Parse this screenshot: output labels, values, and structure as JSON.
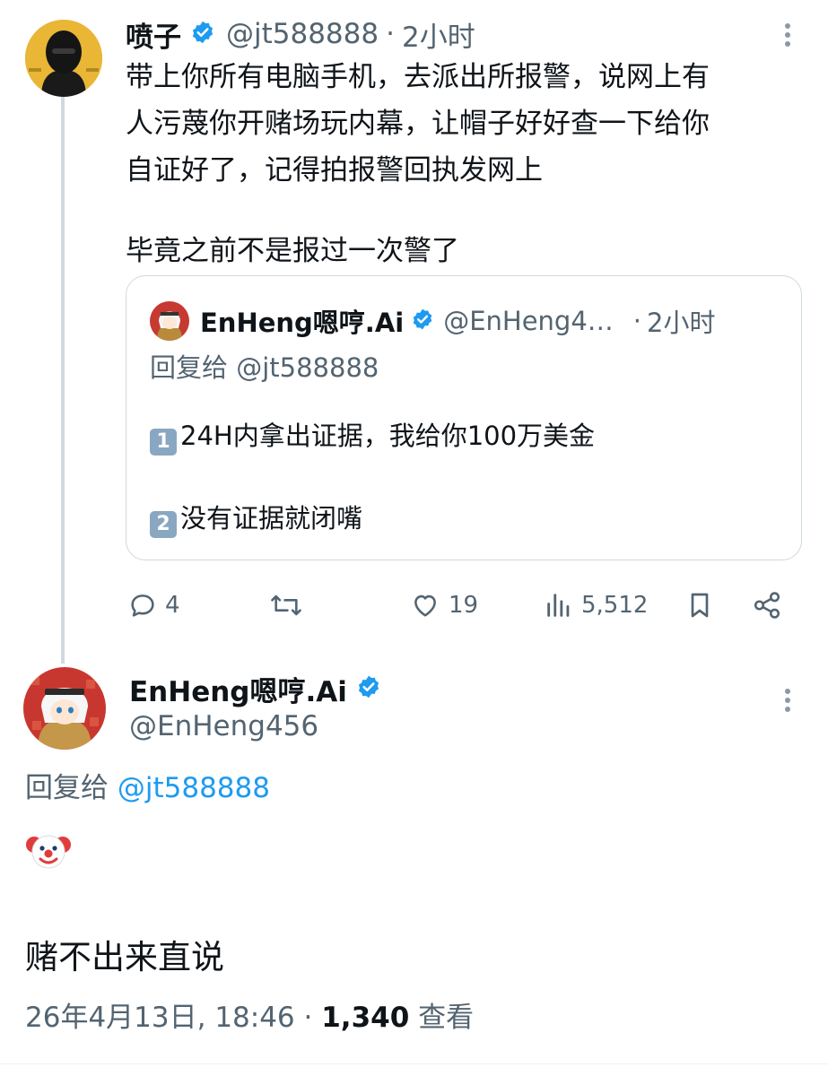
{
  "main_tweet": {
    "display_name": "喷子",
    "handle": "@jt588888",
    "separator": "·",
    "time": "2小时",
    "text_line1": "带上你所有电脑手机，去派出所报警，说网上有",
    "text_line2": "人污蔑你开赌场玩内幕，让帽子好好查一下给你",
    "text_line3": "自证好了，记得拍报警回执发网上",
    "text_line4": "毕竟之前不是报过一次警了"
  },
  "quoted_tweet": {
    "display_name": "EnHeng嗯哼.Ai",
    "handle": "@EnHeng4…",
    "separator": "·",
    "time": "2小时",
    "reply_to": "回复给 @jt588888",
    "item1_key": "1",
    "item1_text": "24H内拿出证据，我给你100万美金",
    "item2_key": "2",
    "item2_text": "没有证据就闭嘴"
  },
  "actions": {
    "reply_count": "4",
    "retweet_count": "",
    "like_count": "19",
    "views_count": "5,512"
  },
  "focused_tweet": {
    "display_name": "EnHeng嗯哼.Ai",
    "handle": "@EnHeng456",
    "reply_prefix": "回复给 ",
    "reply_handle": "@jt588888",
    "emoji": "🤡",
    "text": "赌不出来直说",
    "timestamp": "26年4月13日, 18:46 · ",
    "views_number": "1,340",
    "views_label": " 查看"
  },
  "colors": {
    "accent": "#1d9bf0",
    "text": "#0f1419",
    "secondary": "#536471",
    "border": "#cfd9de"
  },
  "icons": [
    "verified-badge-icon",
    "more-options-icon",
    "reply-icon",
    "retweet-icon",
    "like-icon",
    "views-icon",
    "bookmark-icon",
    "share-icon"
  ]
}
